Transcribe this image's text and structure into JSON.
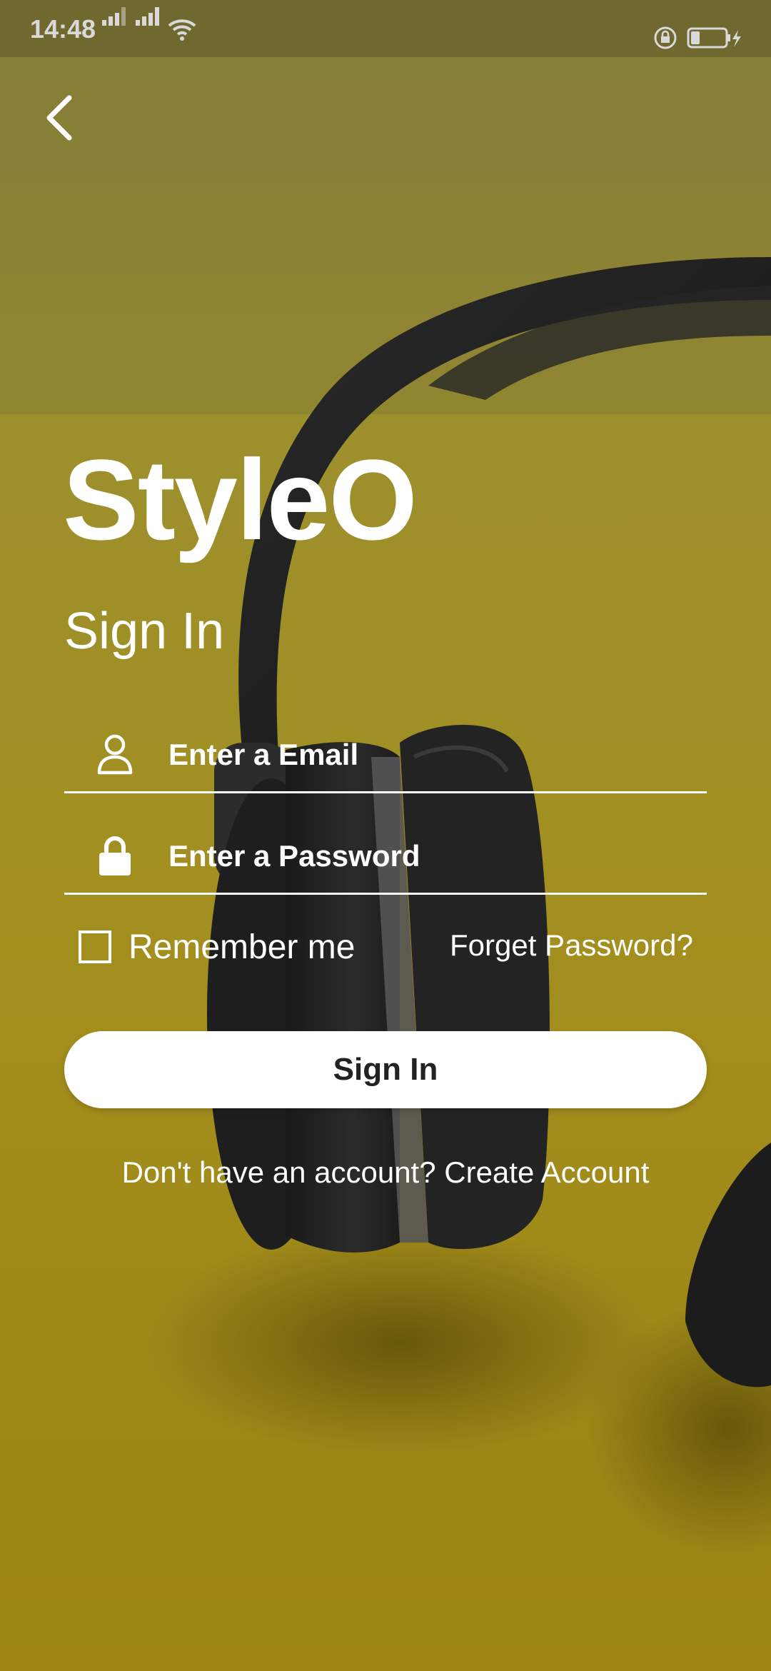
{
  "status_bar": {
    "time": "14:48"
  },
  "header": {
    "back_icon": "chevron-left-icon"
  },
  "brand": "StyleO",
  "title": "Sign In",
  "form": {
    "email_placeholder": "Enter a Email",
    "email_icon": "user-icon",
    "password_placeholder": "Enter a Password",
    "password_icon": "lock-icon",
    "remember_label": "Remember me",
    "remember_checked": false,
    "forgot_label": "Forget Password?",
    "submit_label": "Sign In"
  },
  "footer": {
    "prompt": "Don't have an account?",
    "create_label": "Create Account"
  },
  "colors": {
    "background": "#a38f1f",
    "text": "#ffffff",
    "button_bg": "#ffffff",
    "button_text": "#222222"
  }
}
